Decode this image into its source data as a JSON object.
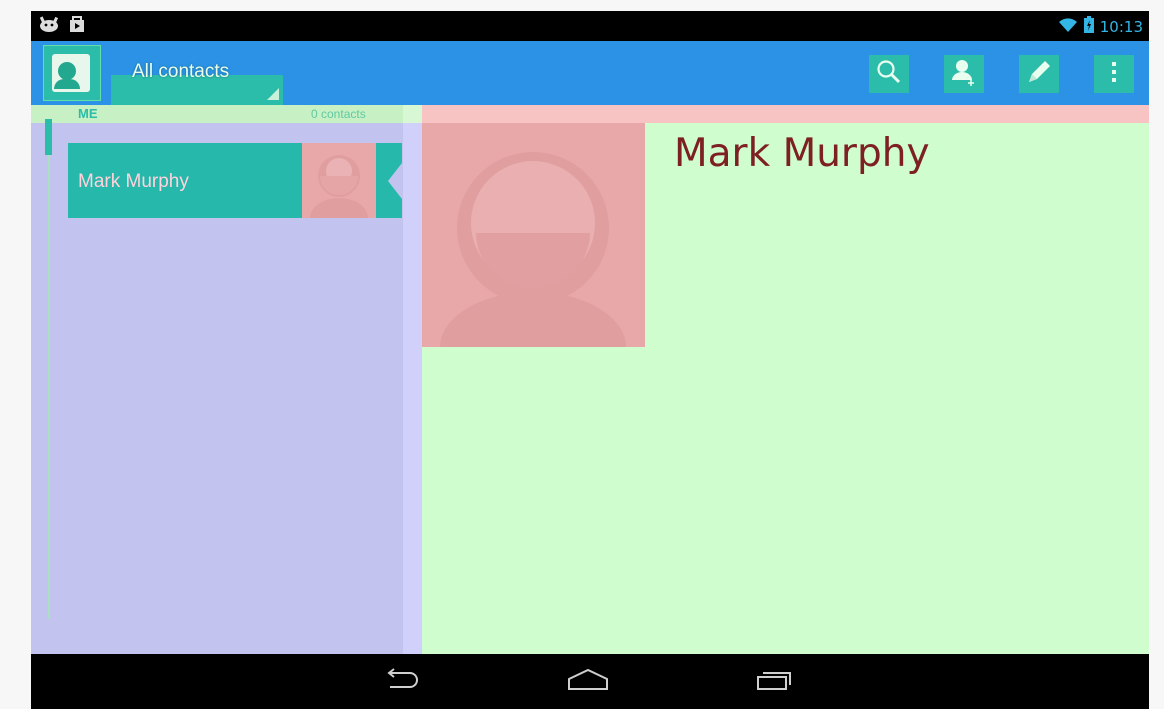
{
  "status_bar": {
    "time": "10:13",
    "icons": [
      "android-icon",
      "shopping-bag-icon",
      "wifi-icon",
      "battery-icon"
    ]
  },
  "action_bar": {
    "spinner_label": "All contacts",
    "actions": [
      "search-icon",
      "add-contact-icon",
      "edit-icon",
      "overflow-menu-icon"
    ]
  },
  "contact_list": {
    "section_label": "ME",
    "section_count": "0 contacts",
    "items": [
      {
        "name": "Mark Murphy"
      }
    ]
  },
  "detail": {
    "name": "Mark Murphy"
  },
  "nav_bar": {
    "buttons": [
      "back-icon",
      "home-icon",
      "recents-icon"
    ]
  },
  "colors": {
    "accent": "#33b5e5",
    "action_bar": "#2b92e6",
    "teal": "#2bbda9",
    "left_pane": "#c3c3f0",
    "right_pane": "#d0fdcd",
    "photo": "#e8a7a9",
    "name_text": "#7d2024"
  }
}
